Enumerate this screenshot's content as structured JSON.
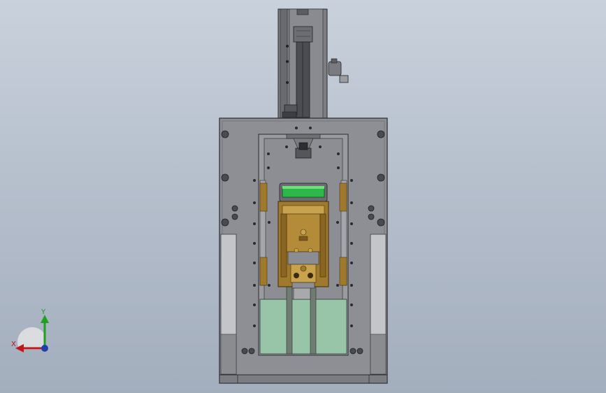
{
  "viewport": {
    "background_top": "#c9d1dc",
    "background_bottom": "#a3aebd"
  },
  "model": {
    "frame_color": "#8e8f94",
    "frame_dark": "#5c5d62",
    "slot_color": "#b9babd",
    "brass_color": "#a07a2c",
    "brass_light": "#c9a24e",
    "green_part_color": "#2fb84a",
    "glass_color": "#98c4a8"
  },
  "triad": {
    "x_label": "X",
    "y_label": "Y",
    "x_color": "#c01818",
    "y_color": "#20a020",
    "z_color": "#1f3fb0"
  }
}
